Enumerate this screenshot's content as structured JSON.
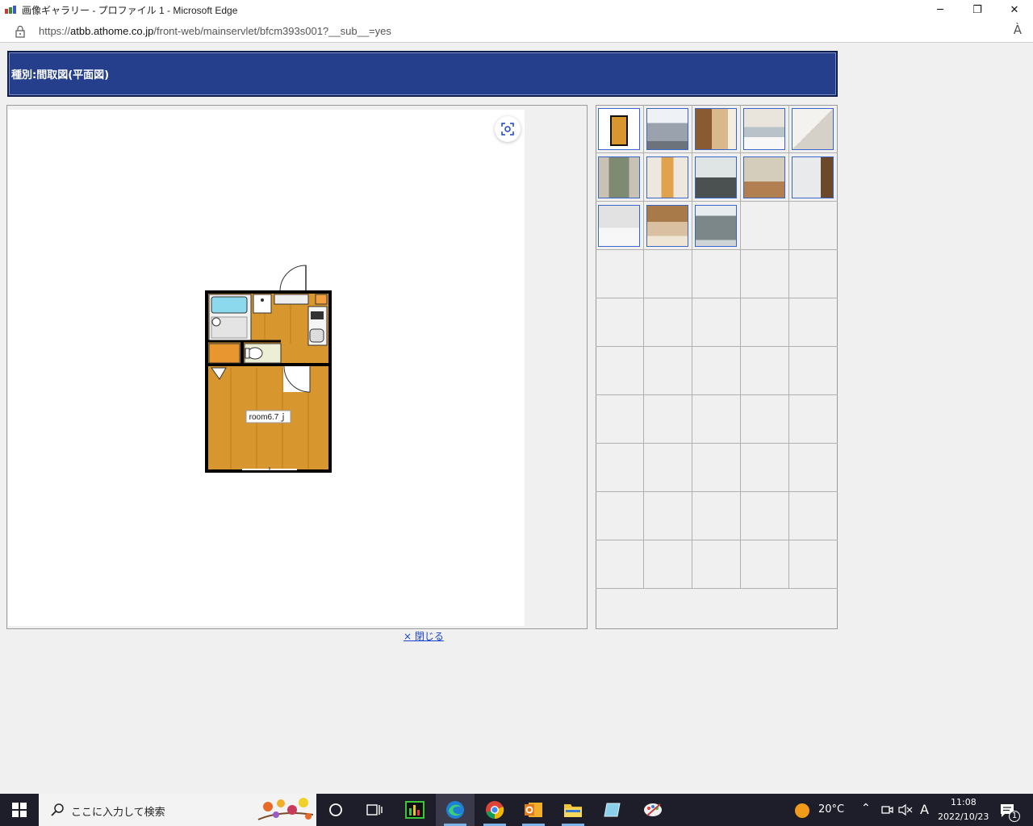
{
  "window": {
    "title": "画像ギャラリー - プロファイル 1 - Microsoft Edge",
    "minimize": "─",
    "restore": "❐",
    "close": "✕"
  },
  "address": {
    "url_prefix": "https://",
    "url_host": "atbb.athome.co.jp",
    "url_path": "/front-web/mainservlet/bfcm393s001?__sub__=yes",
    "read_aloud": "À"
  },
  "page": {
    "category_header": "種別:間取図(平面図)",
    "floorplan_label": "room6.7ｊ",
    "close_link": "× 閉じる"
  },
  "thumbnails": [
    {
      "kind": "floorplan"
    },
    {
      "kind": "exterior"
    },
    {
      "kind": "room-warm"
    },
    {
      "kind": "kitchen"
    },
    {
      "kind": "bath"
    },
    {
      "kind": "window"
    },
    {
      "kind": "hallway"
    },
    {
      "kind": "interior-dark"
    },
    {
      "kind": "room-wood"
    },
    {
      "kind": "intercom"
    },
    {
      "kind": "room-light"
    },
    {
      "kind": "room-furnished"
    },
    {
      "kind": "building"
    }
  ],
  "taskbar": {
    "search_placeholder": "ここに入力して検索",
    "weather": "20°C",
    "ime": "A",
    "time": "11:08",
    "date": "2022/10/23",
    "notification_count": "1"
  },
  "colors": {
    "header_bg": "#253f8c",
    "thumb_border": "#3b66c9",
    "link": "#1a44c9",
    "taskbar_bg": "#1e1e2a"
  }
}
